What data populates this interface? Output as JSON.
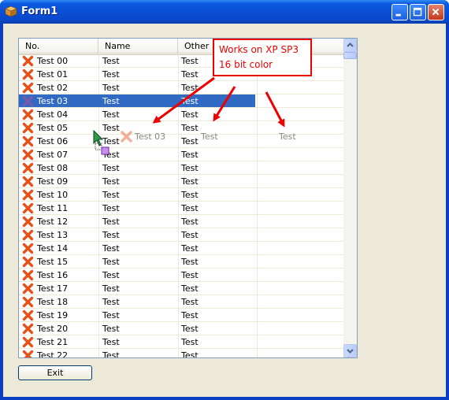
{
  "window": {
    "title": "Form1"
  },
  "listview": {
    "columns": [
      "No.",
      "Name",
      "Other"
    ],
    "rows": [
      {
        "no": "Test 00",
        "name": "Test",
        "other": "Test"
      },
      {
        "no": "Test 01",
        "name": "Test",
        "other": "Test"
      },
      {
        "no": "Test 02",
        "name": "Test",
        "other": "Test"
      },
      {
        "no": "Test 03",
        "name": "Test",
        "other": "Test",
        "selected": true
      },
      {
        "no": "Test 04",
        "name": "Test",
        "other": "Test"
      },
      {
        "no": "Test 05",
        "name": "Test",
        "other": "Test"
      },
      {
        "no": "Test 06",
        "name": "Test",
        "other": "Test"
      },
      {
        "no": "Test 07",
        "name": "Test",
        "other": "Test"
      },
      {
        "no": "Test 08",
        "name": "Test",
        "other": "Test"
      },
      {
        "no": "Test 09",
        "name": "Test",
        "other": "Test"
      },
      {
        "no": "Test 10",
        "name": "Test",
        "other": "Test"
      },
      {
        "no": "Test 11",
        "name": "Test",
        "other": "Test"
      },
      {
        "no": "Test 12",
        "name": "Test",
        "other": "Test"
      },
      {
        "no": "Test 13",
        "name": "Test",
        "other": "Test"
      },
      {
        "no": "Test 14",
        "name": "Test",
        "other": "Test"
      },
      {
        "no": "Test 15",
        "name": "Test",
        "other": "Test"
      },
      {
        "no": "Test 16",
        "name": "Test",
        "other": "Test"
      },
      {
        "no": "Test 17",
        "name": "Test",
        "other": "Test"
      },
      {
        "no": "Test 18",
        "name": "Test",
        "other": "Test"
      },
      {
        "no": "Test 19",
        "name": "Test",
        "other": "Test"
      },
      {
        "no": "Test 20",
        "name": "Test",
        "other": "Test"
      },
      {
        "no": "Test 21",
        "name": "Test",
        "other": "Test"
      },
      {
        "no": "Test 22",
        "name": "Test",
        "other": "Test"
      }
    ],
    "row_icon": "red-x-icon"
  },
  "drag_ghost": {
    "no": "Test 03",
    "name": "Test",
    "other": "Test"
  },
  "annotation": {
    "line1": "Works on XP SP3",
    "line2": "16 bit color",
    "color": "#e00000"
  },
  "buttons": {
    "exit": "Exit"
  },
  "colors": {
    "selection": "#316ac5",
    "titlebar": "#0a4fd6",
    "face": "#ece9d8"
  }
}
